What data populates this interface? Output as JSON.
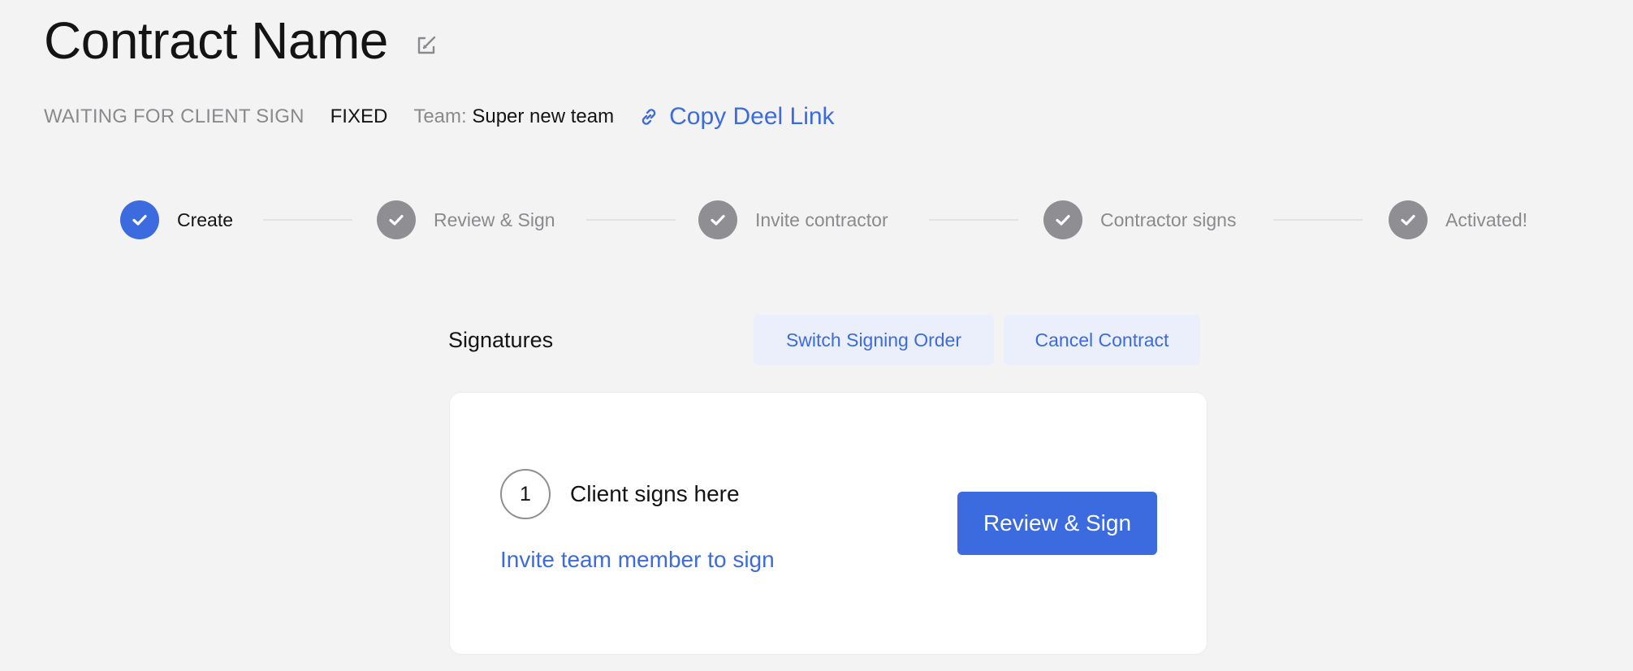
{
  "header": {
    "title": "Contract Name",
    "edit_icon": "edit-external-icon"
  },
  "meta": {
    "status": "WAITING FOR CLIENT SIGN",
    "rate_type": "FIXED",
    "team_label": "Team:",
    "team_name": "Super new team",
    "copy_link_label": "Copy Deel Link",
    "copy_link_icon": "link-icon"
  },
  "stepper": {
    "steps": [
      {
        "label": "Create",
        "state": "active"
      },
      {
        "label": "Review & Sign",
        "state": "complete"
      },
      {
        "label": "Invite contractor",
        "state": "complete"
      },
      {
        "label": "Contractor signs",
        "state": "complete"
      },
      {
        "label": "Activated!",
        "state": "complete"
      }
    ]
  },
  "signatures": {
    "title": "Signatures",
    "switch_order_label": "Switch Signing Order",
    "cancel_contract_label": "Cancel Contract",
    "signer": {
      "number": "1",
      "label": "Client signs here",
      "invite_label": "Invite team member to sign",
      "review_sign_label": "Review & Sign"
    }
  },
  "colors": {
    "accent": "#3b6bdf",
    "inactive": "#8e8e93",
    "background": "#f4f3f4",
    "secondary_button_bg": "#ebeffc"
  }
}
